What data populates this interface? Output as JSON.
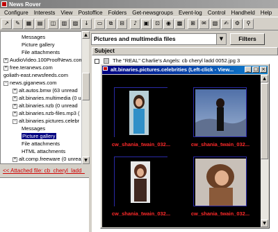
{
  "window": {
    "title": "News Rover"
  },
  "menu": [
    "Configure",
    "Interests",
    "View",
    "Postoffice",
    "Folders",
    "Get-newsgroups",
    "Event-log",
    "Control",
    "Handheld",
    "Help"
  ],
  "toolbar": {
    "buttons": [
      {
        "name": "toolbar-button-1-icon",
        "glyph": "↗"
      },
      {
        "name": "toolbar-button-2-icon",
        "glyph": "✎"
      },
      {
        "name": "toolbar-button-3-icon",
        "glyph": "▦"
      },
      {
        "name": "toolbar-button-4-icon",
        "glyph": "▤"
      },
      {
        "name": "toolbar-button-5-icon",
        "glyph": "◫"
      },
      {
        "name": "toolbar-button-6-icon",
        "glyph": "▥"
      },
      {
        "name": "toolbar-button-7-icon",
        "glyph": "▨"
      },
      {
        "name": "toolbar-button-8-icon",
        "glyph": "↓"
      },
      {
        "name": "toolbar-button-9-icon",
        "glyph": "▭"
      },
      {
        "name": "toolbar-button-10-icon",
        "glyph": "⧉"
      },
      {
        "name": "toolbar-button-11-icon",
        "glyph": "⊟"
      },
      {
        "name": "toolbar-button-12-icon",
        "glyph": "♪"
      },
      {
        "name": "toolbar-button-13-icon",
        "glyph": "▣"
      },
      {
        "name": "toolbar-button-14-icon",
        "glyph": "⊡"
      },
      {
        "name": "toolbar-button-15-icon",
        "glyph": "◉"
      },
      {
        "name": "toolbar-button-16-icon",
        "glyph": "▩"
      },
      {
        "name": "toolbar-button-17-icon",
        "glyph": "⊞"
      },
      {
        "name": "toolbar-button-18-icon",
        "glyph": "✉"
      },
      {
        "name": "toolbar-button-19-icon",
        "glyph": "▧"
      },
      {
        "name": "toolbar-button-20-icon",
        "glyph": "✍"
      },
      {
        "name": "toolbar-button-21-icon",
        "glyph": "⚙"
      },
      {
        "name": "toolbar-button-22-icon",
        "glyph": "⚲"
      }
    ]
  },
  "tree": {
    "nodes": [
      {
        "label": "Messages",
        "expander": ""
      },
      {
        "label": "Picture gallery",
        "expander": ""
      },
      {
        "label": "File attachments",
        "expander": ""
      },
      {
        "label": "AudioVideo.100ProofNews.com",
        "expander": "+"
      },
      {
        "label": "free.teranews.com",
        "expander": "+"
      },
      {
        "label": "goliath-east.newsfeeds.com",
        "expander": ""
      },
      {
        "label": "news.giganews.com",
        "expander": "−"
      },
      {
        "label": "alt.autos.bmw (63 unread",
        "expander": "+"
      },
      {
        "label": "alt.binaries.multimedia (0 u",
        "expander": "+"
      },
      {
        "label": "alt.binaries.nzb (0 unread",
        "expander": "+"
      },
      {
        "label": "alt.binaries.nzb-files.mp3 (",
        "expander": "+"
      },
      {
        "label": "alt.binaries.pictures.celebr",
        "expander": "−"
      },
      {
        "label": "Messages",
        "expander": ""
      },
      {
        "label": "Picture gallery",
        "expander": ""
      },
      {
        "label": "File attachments",
        "expander": ""
      },
      {
        "label": "HTML attachments",
        "expander": ""
      },
      {
        "label": "alt.comp.freeware (0 unread",
        "expander": "+"
      }
    ],
    "selected_index": 13
  },
  "attached": {
    "text": "<< Attached file: cb_cheryl_ladd_"
  },
  "filter": {
    "selected": "Pictures and multimedia files",
    "filters_label": "Filters"
  },
  "list": {
    "subject_header": "Subject",
    "article": "The \"REAL\" Charlie's Angels: cb cheryl ladd 0052.jpg 3",
    "right_clips": [
      "j",
      "j",
      "j",
      "j",
      "j"
    ]
  },
  "popup": {
    "title": "alt.binaries.pictures.celebrities  (Left-click - View...",
    "captions": [
      "cw_shania_twain_032...",
      "cw_shania_twain_032...",
      "cw_shania_twain_032...",
      "cw_shania_twain_032..."
    ]
  }
}
